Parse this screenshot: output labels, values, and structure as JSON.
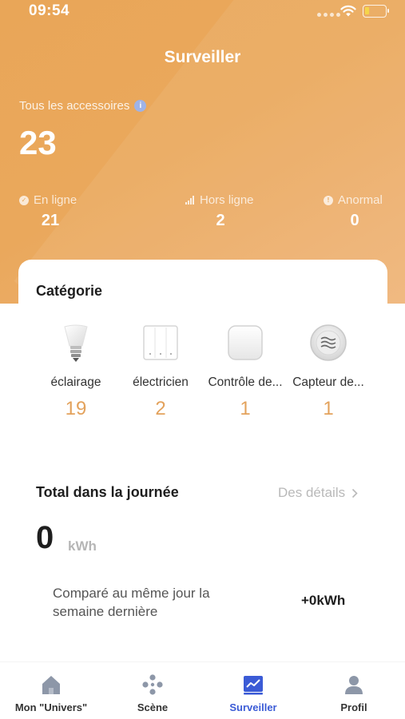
{
  "status_bar": {
    "time": "09:54"
  },
  "header": {
    "title": "Surveiller",
    "all_accessories_label": "Tous les accessoires",
    "all_accessories_count": "23",
    "stats": [
      {
        "icon": "check-circle-icon",
        "label": "En ligne",
        "value": "21"
      },
      {
        "icon": "signal-bars-icon",
        "label": "Hors ligne",
        "value": "2"
      },
      {
        "icon": "alert-circle-icon",
        "label": "Anormal",
        "value": "0"
      }
    ]
  },
  "category": {
    "title": "Catégorie",
    "items": [
      {
        "icon": "bulb-icon",
        "name": "éclairage",
        "count": "19"
      },
      {
        "icon": "switch-panel-icon",
        "name": "électricien",
        "count": "2"
      },
      {
        "icon": "control-box-icon",
        "name": "Contrôle de...",
        "count": "1"
      },
      {
        "icon": "sensor-icon",
        "name": "Capteur de...",
        "count": "1"
      }
    ]
  },
  "energy": {
    "title": "Total dans la journée",
    "details_label": "Des détails",
    "value": "0",
    "unit": "kWh",
    "compare_label": "Comparé au même jour la semaine dernière",
    "compare_value": "+0kWh"
  },
  "tabbar": {
    "tabs": [
      {
        "icon": "home-icon",
        "label": "Mon \"Univers\""
      },
      {
        "icon": "scene-dots-icon",
        "label": "Scène"
      },
      {
        "icon": "monitor-chart-icon",
        "label": "Surveiller",
        "active": true
      },
      {
        "icon": "profile-icon",
        "label": "Profil"
      }
    ]
  },
  "colors": {
    "header": "#e9a658",
    "accent_count": "#e3a25c",
    "active_tab": "#3b5bd6"
  }
}
